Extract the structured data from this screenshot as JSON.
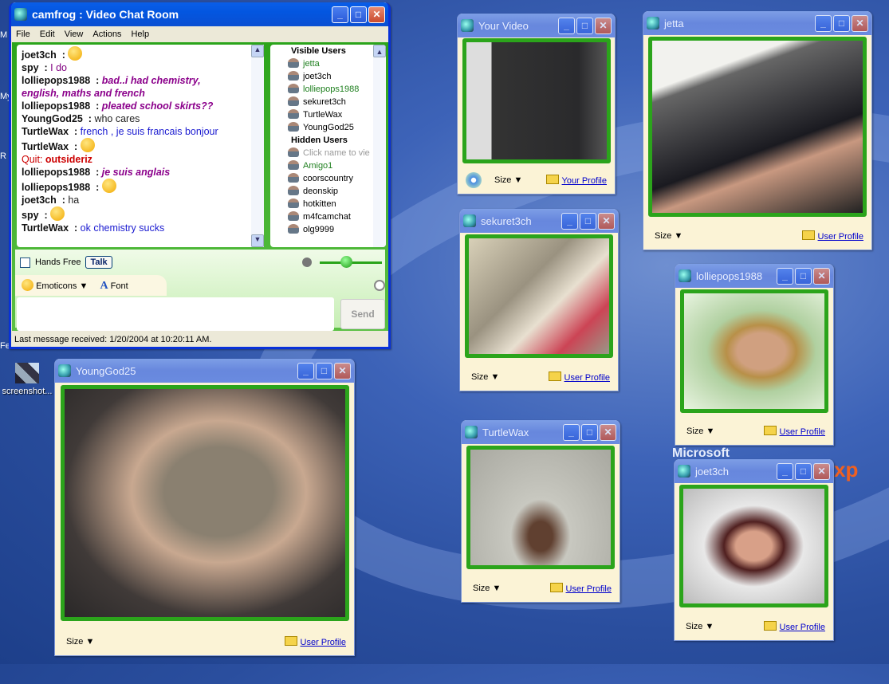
{
  "main": {
    "title": "camfrog : Video Chat Room",
    "menu": [
      "File",
      "Edit",
      "View",
      "Actions",
      "Help"
    ],
    "messages": [
      {
        "user": "joet3ch",
        "text": "",
        "emoticon": "smile",
        "color": "#000"
      },
      {
        "user": "spy",
        "text": "I do",
        "color": "#800080",
        "style": "normal"
      },
      {
        "user": "lolliepops1988",
        "text": "bad..i had chemistry,",
        "color": "#8b008b",
        "style": "bolditalic"
      },
      {
        "user": "",
        "text": "english, maths and french",
        "color": "#8b008b",
        "style": "bolditalic"
      },
      {
        "user": "lolliepops1988",
        "text": "pleated school skirts??",
        "color": "#8b008b",
        "style": "bolditalic"
      },
      {
        "user": "YoungGod25",
        "text": "who cares",
        "color": "#222",
        "style": "normal"
      },
      {
        "user": "TurtleWax",
        "text": "french , je suis francais bonjour",
        "color": "#1a1ad0",
        "style": "normal"
      },
      {
        "user": "TurtleWax",
        "text": "",
        "emoticon": "wink"
      },
      {
        "system": "Quit:",
        "name": "outsideriz"
      },
      {
        "user": "lolliepops1988",
        "text": "je suis anglais",
        "color": "#8b008b",
        "style": "bolditalic"
      },
      {
        "user": "lolliepops1988",
        "text": "",
        "emoticon": "tongue"
      },
      {
        "user": "joet3ch",
        "text": "ha",
        "color": "#222",
        "style": "normal"
      },
      {
        "user": "spy",
        "text": "",
        "emoticon": "smile"
      },
      {
        "user": "TurtleWax",
        "text": "ok chemistry sucks",
        "color": "#1a1ad0",
        "style": "normal"
      }
    ],
    "visible_header": "Visible Users",
    "visible_users": [
      {
        "name": "jetta",
        "color": "#208020"
      },
      {
        "name": "joet3ch",
        "color": "#000"
      },
      {
        "name": "lolliepops1988",
        "color": "#208020"
      },
      {
        "name": "sekuret3ch",
        "color": "#000"
      },
      {
        "name": "TurtleWax",
        "color": "#000"
      },
      {
        "name": "YoungGod25",
        "color": "#000"
      }
    ],
    "hidden_header": "Hidden Users",
    "hidden_hint": "Click name to vie",
    "hidden_users": [
      {
        "name": "Amigo1",
        "color": "#208020"
      },
      {
        "name": "coorscountry",
        "color": "#000"
      },
      {
        "name": "deonskip",
        "color": "#000"
      },
      {
        "name": "hotkitten",
        "color": "#000"
      },
      {
        "name": "m4fcamchat",
        "color": "#000"
      },
      {
        "name": "olg9999",
        "color": "#000"
      }
    ],
    "hands_free": "Hands Free",
    "talk": "Talk",
    "emoticons": "Emoticons",
    "font": "Font",
    "send": "Send",
    "status": "Last message received: 1/20/2004 at 10:20:11 AM."
  },
  "windows": [
    {
      "title": "Your Video",
      "profile": "Your Profile",
      "size": "Size",
      "own": true
    },
    {
      "title": "jetta",
      "profile": "User Profile",
      "size": "Size"
    },
    {
      "title": "sekuret3ch",
      "profile": "User Profile",
      "size": "Size"
    },
    {
      "title": "lolliepops1988",
      "profile": "User Profile",
      "size": "Size"
    },
    {
      "title": "TurtleWax",
      "profile": "User Profile",
      "size": "Size"
    },
    {
      "title": "joet3ch",
      "profile": "User Profile",
      "size": "Size"
    },
    {
      "title": "YoungGod25",
      "profile": "User Profile",
      "size": "Size"
    }
  ],
  "desktop": {
    "icon_label": "screenshot...",
    "logo": "Microsoft",
    "logo_suffix": "xp"
  },
  "colors": {
    "accent_green": "#2ba41b",
    "titlebar_active": "#0356e0",
    "link": "#0000cc"
  }
}
